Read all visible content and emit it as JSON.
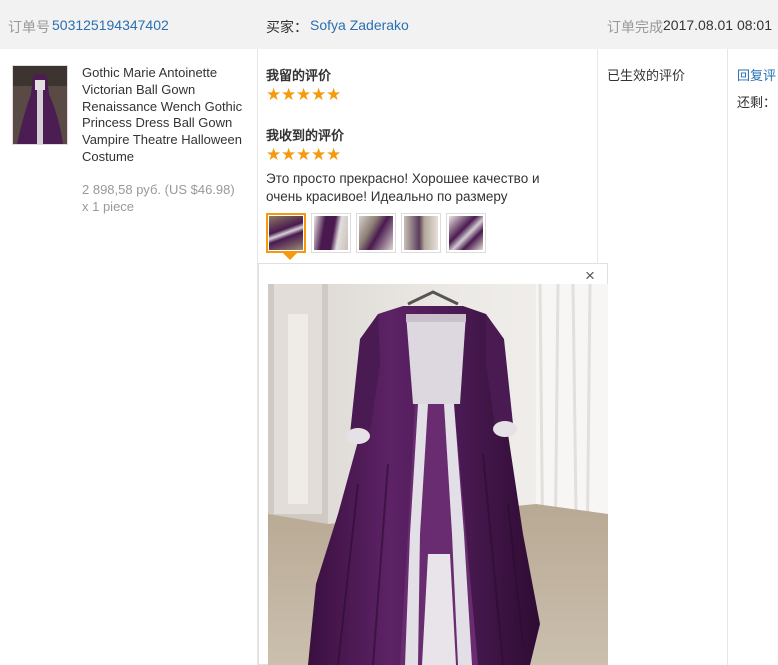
{
  "header": {
    "order_label": "订单号",
    "order_number": "503125194347402",
    "buyer_label": "买家：",
    "buyer_name": "Sofya Zaderako",
    "status_label": "订单完成",
    "status_date": "2017.08.01 08:01"
  },
  "product": {
    "title": "Gothic Marie Antoinette Victorian Ball Gown Renaissance Wench Gothic Princess Dress Ball Gown Vampire Theatre Halloween Costume",
    "price": "2 898,58 руб. (US $46.98)",
    "quantity": "x 1 piece"
  },
  "my_review": {
    "label": "我留的评价",
    "rating": 5
  },
  "received_review": {
    "label": "我收到的评价",
    "rating": 5,
    "text": "Это просто прекрасно! Хорошее качество и очень красивое! Идеально по размеру",
    "photo_count": 5,
    "selected_photo": 1
  },
  "status_col": {
    "effective_label": "已生效的评价"
  },
  "actions": {
    "reply_label": "回复评",
    "remaining_label": "还剩："
  },
  "viewer": {
    "close_label": "×"
  },
  "colors": {
    "star": "#f59a0c",
    "link": "#2a6fb3",
    "header_bg": "#f2f2f2",
    "dress": "#4a1a4f"
  }
}
